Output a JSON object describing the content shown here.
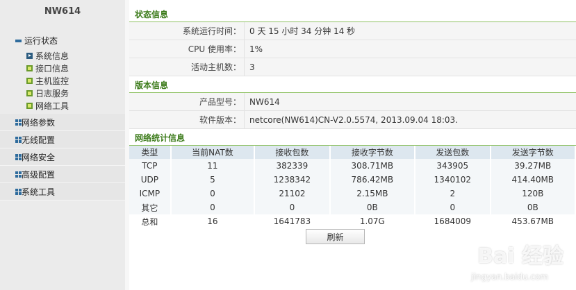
{
  "sidebar": {
    "brand": "NW614",
    "expanded_group": {
      "label": "运行状态",
      "items": [
        {
          "label": "系统信息"
        },
        {
          "label": "接口信息"
        },
        {
          "label": "主机监控"
        },
        {
          "label": "日志服务"
        },
        {
          "label": "网络工具"
        }
      ]
    },
    "groups": [
      {
        "label": "网络参数"
      },
      {
        "label": "无线配置"
      },
      {
        "label": "网络安全"
      },
      {
        "label": "高级配置"
      },
      {
        "label": "系统工具"
      }
    ]
  },
  "status": {
    "title": "状态信息",
    "rows": [
      {
        "label": "系统运行时间：",
        "value": "0 天 15 小时 34 分钟 14 秒"
      },
      {
        "label": "CPU 使用率：",
        "value": "1%"
      },
      {
        "label": "活动主机数：",
        "value": "3"
      }
    ]
  },
  "version": {
    "title": "版本信息",
    "rows": [
      {
        "label": "产品型号：",
        "value": "NW614"
      },
      {
        "label": "软件版本：",
        "value": "netcore(NW614)CN-V2.0.5574, 2013.09.04 18:03."
      }
    ]
  },
  "stats": {
    "title": "网络统计信息",
    "headers": [
      "类型",
      "当前NAT数",
      "接收包数",
      "接收字节数",
      "发送包数",
      "发送字节数"
    ],
    "rows": [
      [
        "TCP",
        "11",
        "382339",
        "308.71MB",
        "343905",
        "39.27MB"
      ],
      [
        "UDP",
        "5",
        "1238342",
        "786.42MB",
        "1340102",
        "414.40MB"
      ],
      [
        "ICMP",
        "0",
        "21102",
        "2.15MB",
        "2",
        "120B"
      ],
      [
        "其它",
        "0",
        "0",
        "0B",
        "0",
        "0B"
      ],
      [
        "总和",
        "16",
        "1641783",
        "1.07G",
        "1684009",
        "453.67MB"
      ]
    ],
    "refresh_label": "刷新"
  },
  "watermark": {
    "brand": "Bai 经验",
    "url": "jingyan.baidu.com"
  }
}
